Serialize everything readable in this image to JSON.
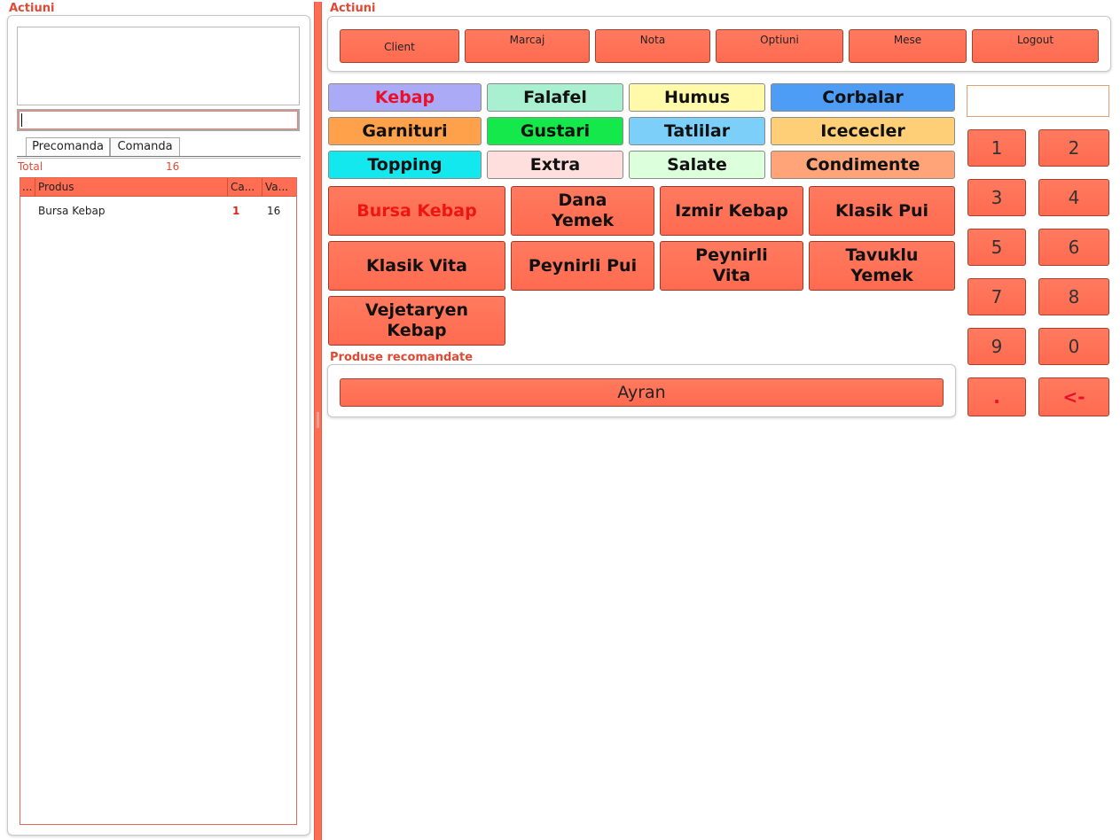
{
  "left": {
    "title": "Actiuni",
    "notes_value": "",
    "search_value": "",
    "tabs": [
      "Precomanda",
      "Comanda"
    ],
    "active_tab": "Precomanda",
    "total_label": "Total",
    "total_value": "16",
    "table": {
      "columns": [
        "...",
        "Produs",
        "Ca...",
        "Va..."
      ],
      "rows": [
        {
          "nr": "",
          "produs": "Bursa Kebap",
          "cantitate": "1",
          "valoare": "16"
        }
      ]
    }
  },
  "actions": {
    "title": "Actiuni",
    "buttons": [
      "Client",
      "Marcaj",
      "Nota",
      "Optiuni",
      "Mese",
      "Logout"
    ]
  },
  "categories": [
    {
      "label": "Kebap",
      "color": "#aaaaf6",
      "selected": true
    },
    {
      "label": "Falafel",
      "color": "#a8f0d0"
    },
    {
      "label": "Humus",
      "color": "#fffaaa"
    },
    {
      "label": "Corbalar",
      "color": "#4d9cf6"
    },
    {
      "label": "Garnituri",
      "color": "#ffa04a"
    },
    {
      "label": "Gustari",
      "color": "#14e84a"
    },
    {
      "label": "Tatlilar",
      "color": "#7ccff8"
    },
    {
      "label": "Icececler",
      "color": "#ffcf78"
    },
    {
      "label": "Topping",
      "color": "#12e8ee"
    },
    {
      "label": "Extra",
      "color": "#ffdede"
    },
    {
      "label": "Salate",
      "color": "#dcffdc"
    },
    {
      "label": "Condimente",
      "color": "#ffa478"
    }
  ],
  "products": [
    {
      "line1": "Bursa Kebap",
      "line2": "",
      "selected": true
    },
    {
      "line1": "Dana",
      "line2": "Yemek"
    },
    {
      "line1": "Izmir Kebap",
      "line2": ""
    },
    {
      "line1": "Klasik Pui",
      "line2": ""
    },
    {
      "line1": "Klasik Vita",
      "line2": ""
    },
    {
      "line1": "Peynirli Pui",
      "line2": ""
    },
    {
      "line1": "Peynirli",
      "line2": "Vita"
    },
    {
      "line1": "Tavuklu",
      "line2": "Yemek"
    },
    {
      "line1": "Vejetaryen",
      "line2": "Kebap"
    }
  ],
  "recommended": {
    "title": "Produse recomandate",
    "items": [
      "Ayran"
    ]
  },
  "keypad": {
    "display_value": "",
    "keys": [
      "1",
      "2",
      "3",
      "4",
      "5",
      "6",
      "7",
      "8",
      "9",
      "0",
      ".",
      "<-"
    ]
  },
  "colors": {
    "accent": "#ff6d52",
    "title_red": "#e04a34",
    "selected_text": "#e8102a"
  }
}
